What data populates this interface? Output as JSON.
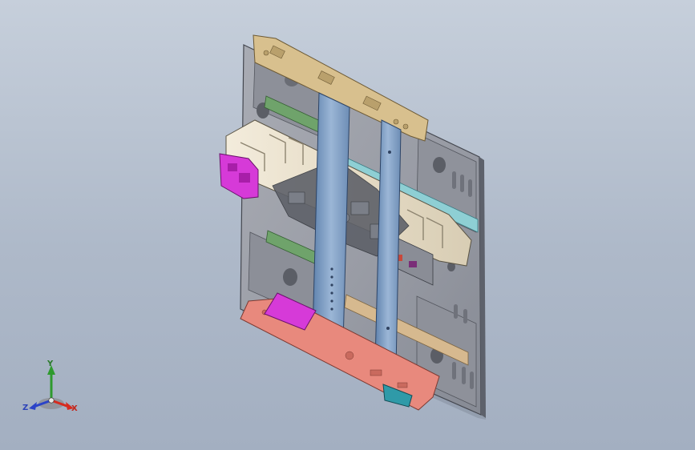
{
  "viewport": {
    "background_top": "#c6cfdb",
    "background_bottom": "#a3afc1"
  },
  "model": {
    "subject": "vehicle-floor-panel-assembly",
    "colors": {
      "panel": "#9a9da6",
      "panel_dark": "#6f737d",
      "front_header": "#d8c08e",
      "rear_header": "#e8897d",
      "longitudinal_rail": "#7fa0c8",
      "cross_member": "#e9e1cf",
      "bracket_magenta": "#d63ad8",
      "crossbar_teal": "#8ecfd4",
      "crossbar_green": "#6fa36b",
      "crossbar_tan": "#d6b98f",
      "bracket_teal": "#2f9aa8"
    }
  },
  "triad": {
    "y_label": "Y",
    "x_label": "X",
    "z_label": "Z",
    "colors": {
      "x": "#d62b1f",
      "y": "#2e9a2e",
      "z": "#2b43c8"
    }
  }
}
